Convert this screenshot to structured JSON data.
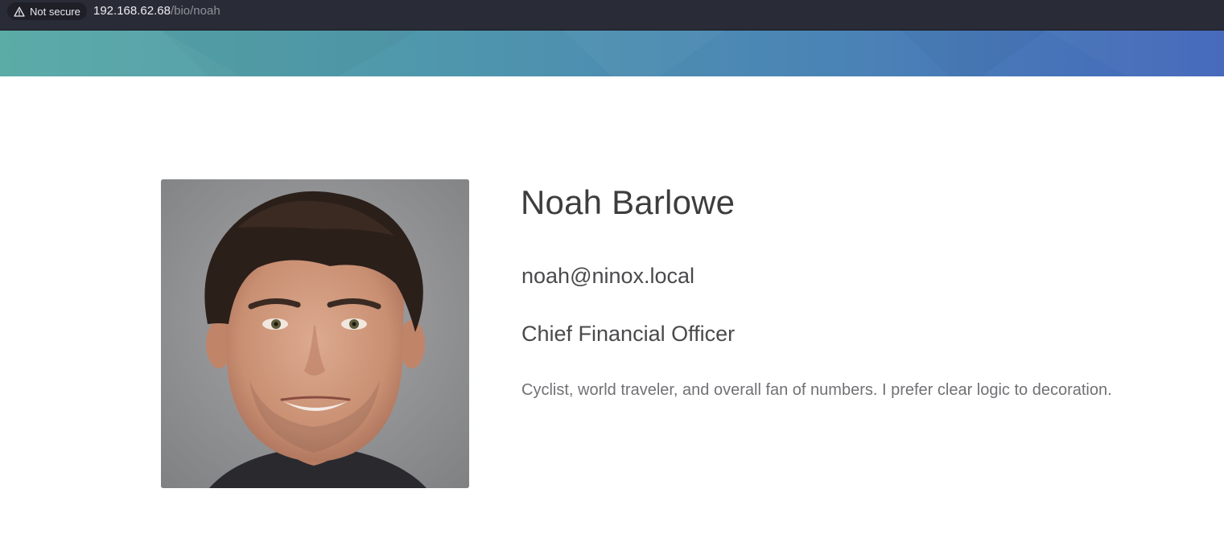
{
  "browser": {
    "security_label": "Not secure",
    "url_host": "192.168.62.68",
    "url_path": "/bio/noah",
    "security_icon": "warning-triangle-icon"
  },
  "banner": {
    "colors": [
      "#56a8a4",
      "#4f97ac",
      "#4a82b6",
      "#4467bb"
    ]
  },
  "profile": {
    "name": "Noah Barlowe",
    "email": "noah@ninox.local",
    "role": "Chief Financial Officer",
    "about": "Cyclist, world traveler, and overall fan of numbers. I prefer clear logic to decoration.",
    "photo": "portrait-photo"
  }
}
